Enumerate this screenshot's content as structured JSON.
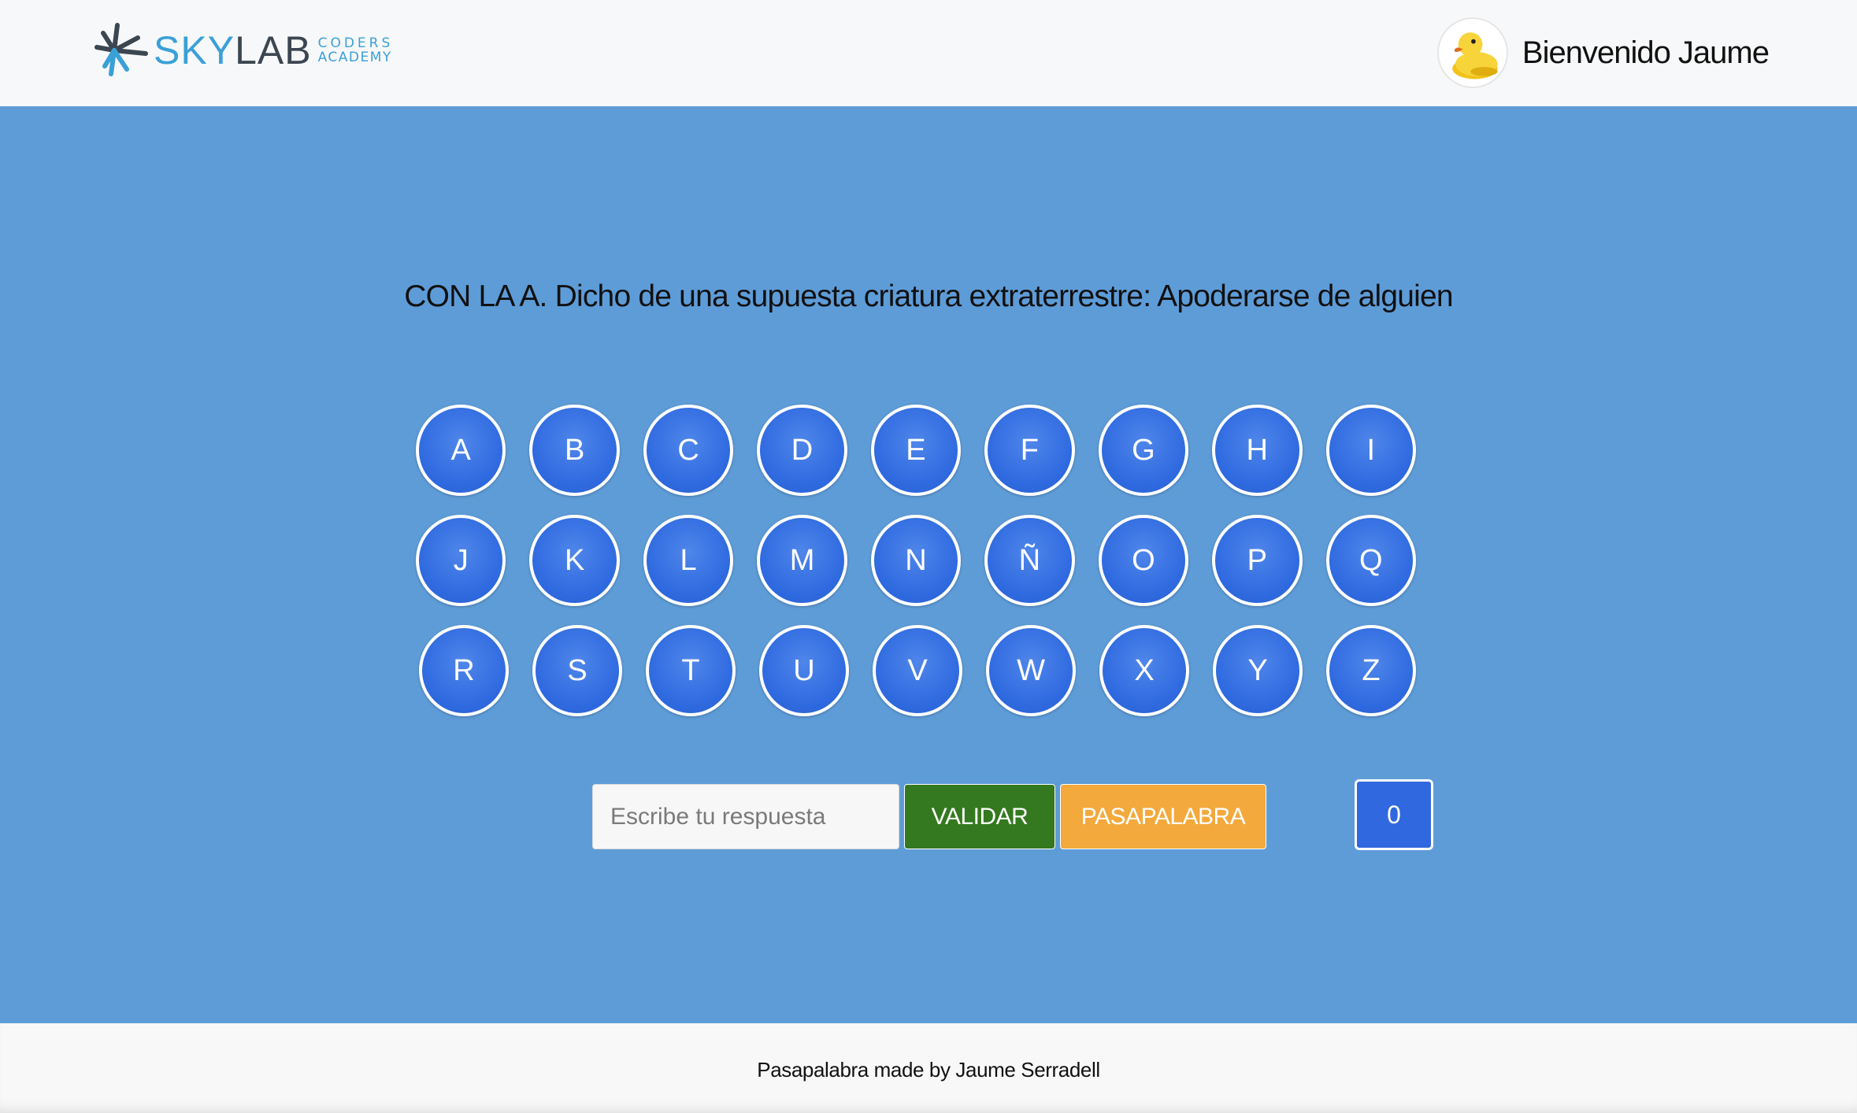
{
  "header": {
    "logo": {
      "brand_primary": "SKY",
      "brand_secondary": "LAB",
      "sub_top": "CODERS",
      "sub_bottom": "ACADEMY"
    },
    "welcome_text": "Bienvenido Jaume",
    "avatar_icon": "rubber-duck-icon"
  },
  "game": {
    "question": "CON LA A. Dicho de una supuesta criatura extraterrestre: Apoderarse de alguien",
    "letters_rows": [
      [
        "A",
        "B",
        "C",
        "D",
        "E",
        "F",
        "G",
        "H",
        "I"
      ],
      [
        "J",
        "K",
        "L",
        "M",
        "N",
        "Ñ",
        "O",
        "P",
        "Q"
      ],
      [
        "R",
        "S",
        "T",
        "U",
        "V",
        "W",
        "X",
        "Y",
        "Z"
      ]
    ],
    "answer_placeholder": "Escribe tu respuesta",
    "answer_value": "",
    "validate_label": "VALIDAR",
    "skip_label": "PASAPALABRA",
    "score": "0"
  },
  "footer": {
    "credit": "Pasapalabra made by Jaume Serradell"
  },
  "colors": {
    "background": "#5e9cd8",
    "letter_fill": "#2f6ae0",
    "validate": "#34791f",
    "skip": "#f3a93b",
    "brand_blue": "#3aa0d8"
  }
}
